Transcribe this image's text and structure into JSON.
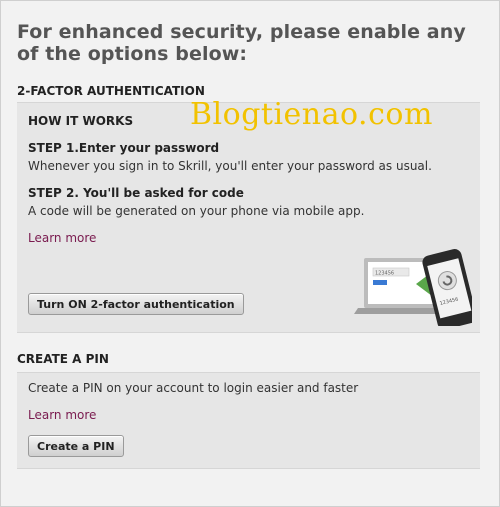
{
  "heading": "For enhanced security, please enable any of the options below:",
  "watermark": "Blogtienao.com",
  "two_factor": {
    "section_title": "2-FACTOR AUTHENTICATION",
    "how_it_works": "HOW IT WORKS",
    "step1_title": "STEP 1.Enter your password",
    "step1_text": "Whenever you sign in to Skrill, you'll enter your password as usual.",
    "step2_title": "STEP 2. You'll be asked for code",
    "step2_text": "A code will be generated on your phone via mobile app.",
    "learn_more": "Learn more",
    "button_label": "Turn ON 2-factor authentication",
    "illustration": {
      "laptop_code": "123456",
      "phone_code": "123456",
      "icons": [
        "laptop-icon",
        "smartphone-icon",
        "sync-arrow-icon"
      ]
    }
  },
  "pin": {
    "section_title": "CREATE A PIN",
    "description": "Create a PIN on your account to login easier and faster",
    "learn_more": "Learn more",
    "button_label": "Create a PIN"
  },
  "colors": {
    "link": "#7a1b4f",
    "panel": "#e6e6e6",
    "background": "#f2f2f2",
    "watermark": "#f2c200",
    "accent_green": "#5aa64a"
  }
}
